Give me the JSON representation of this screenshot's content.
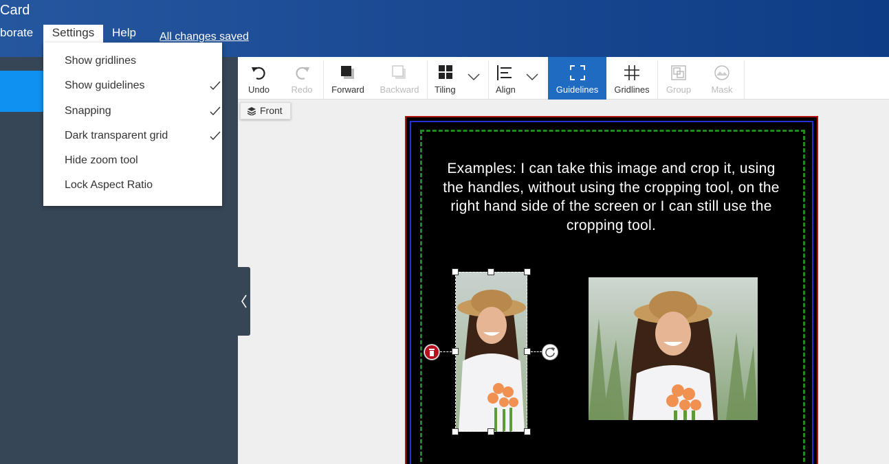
{
  "header": {
    "title": "Card",
    "menu": [
      "borate",
      "Settings",
      "Help"
    ],
    "save_status": "All changes saved"
  },
  "settings_menu": {
    "items": [
      {
        "label": "Show gridlines",
        "checked": false
      },
      {
        "label": "Show guidelines",
        "checked": true
      },
      {
        "label": "Snapping",
        "checked": true
      },
      {
        "label": "Dark transparent grid",
        "checked": true
      },
      {
        "label": "Hide zoom tool",
        "checked": false
      },
      {
        "label": "Lock Aspect Ratio",
        "checked": false
      }
    ]
  },
  "toolbar": {
    "undo": "Undo",
    "redo": "Redo",
    "forward": "Forward",
    "backward": "Backward",
    "tiling": "Tiling",
    "align": "Align",
    "guidelines": "Guidelines",
    "gridlines": "Gridlines",
    "group": "Group",
    "mask": "Mask"
  },
  "layer_badge": "Front",
  "canvas": {
    "text": "Examples: I can take this image and crop it, using the handles, without using the cropping tool, on the right hand side of the screen or I can still use the cropping tool."
  },
  "colors": {
    "header_start": "#25579f",
    "header_end": "#0e3c85",
    "accent_blue": "#0f91f2",
    "panel": "#364656",
    "active_tool": "#1e6bc1",
    "card_border": "#b01212",
    "bleed_line": "#2430d8",
    "safe_line": "#1d8c1d"
  }
}
